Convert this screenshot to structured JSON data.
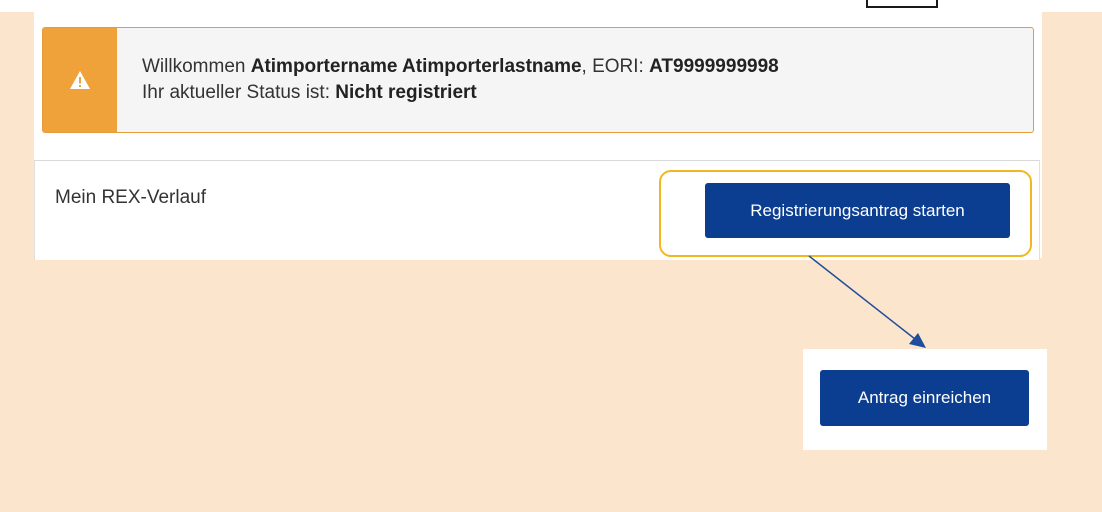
{
  "alert": {
    "greeting": "Willkommen ",
    "user_name": "Atimportername Atimporterlastname",
    "eori_label": ", EORI: ",
    "eori_value": "AT9999999998",
    "status_label": "Ihr aktueller Status ist: ",
    "status_value": "Nicht registriert",
    "icon": "warning-icon",
    "accent_color": "#f0a23a"
  },
  "history": {
    "title": "Mein REX-Verlauf",
    "start_button_label": "Registrierungsantrag starten"
  },
  "submit": {
    "button_label": "Antrag einreichen"
  },
  "colors": {
    "background": "#fce5cd",
    "button": "#0b3d91",
    "highlight": "#f2b720",
    "arrow": "#1f4e9c"
  }
}
